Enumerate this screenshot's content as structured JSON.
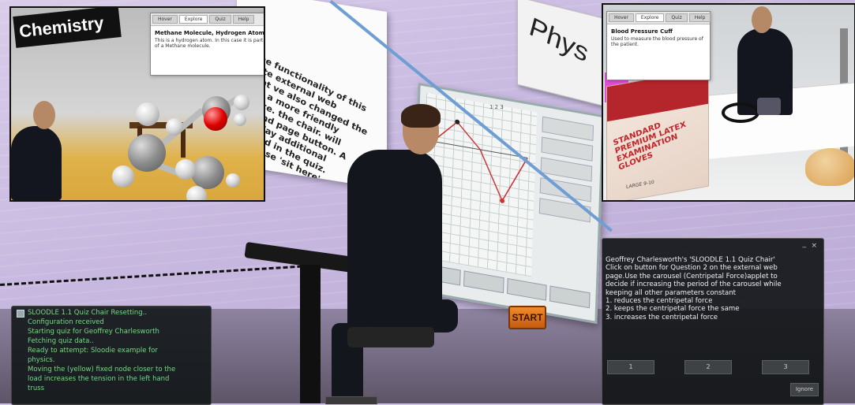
{
  "scene": {
    "physics_sign": "Phys",
    "instructions_text": "nd the functionality of this tegrate external web content ve also changed the default a more friendly sequence. the chair. will appear. nd page button. A web display additional content led in the quiz. chair. Choose 'sit here'. egin.",
    "start_button": "START",
    "graph_page_indicator": "1 2 3"
  },
  "inset_left": {
    "sign": "Chemistry",
    "popup": {
      "tabs": [
        "Hover",
        "Explore",
        "Quiz",
        "Help"
      ],
      "active_tab": "Explore",
      "title": "Methane Molecule, Hydrogen Atom",
      "description": "This is a hydrogen atom. In this case it is part of a Methane molecule."
    }
  },
  "inset_right": {
    "popup": {
      "tabs": [
        "Hover",
        "Explore",
        "Quiz",
        "Help"
      ],
      "active_tab": "Explore",
      "title": "Blood Pressure Cuff",
      "description": "Used to measure the blood pressure of the patient."
    },
    "glove_box_label": "STANDARD PREMIUM LATEX EXAMINATION GLOVES",
    "glove_box_size": "LARGE 9-10"
  },
  "chat": {
    "lines": [
      "SLOODLE 1.1 Quiz Chair Resetting..",
      "Configuration received",
      "Starting quiz for Geoffrey Charlesworth",
      "Fetching quiz data..",
      "Ready to attempt: Sloodie example for",
      "physics.",
      " Moving the (yellow) fixed node closer to the",
      "load increases the tension in the left hand",
      "truss"
    ]
  },
  "quiz_dialog": {
    "minimize": "_",
    "close": "×",
    "lines": [
      "Geoffrey Charlesworth's 'SLOODLE 1.1 Quiz Chair'",
      "Click on button for Question 2 on the external web",
      "page.Use the carousel (Centripetal Force)applet to",
      "decide if increasing the period of the carousel while",
      "keeping all other parameters constant",
      "1. reduces the centripetal force",
      "2. keeps the centripetal force the same",
      "3. increases the centripetal force"
    ],
    "buttons": [
      "1",
      "2",
      "3"
    ],
    "ignore": "Ignore"
  }
}
